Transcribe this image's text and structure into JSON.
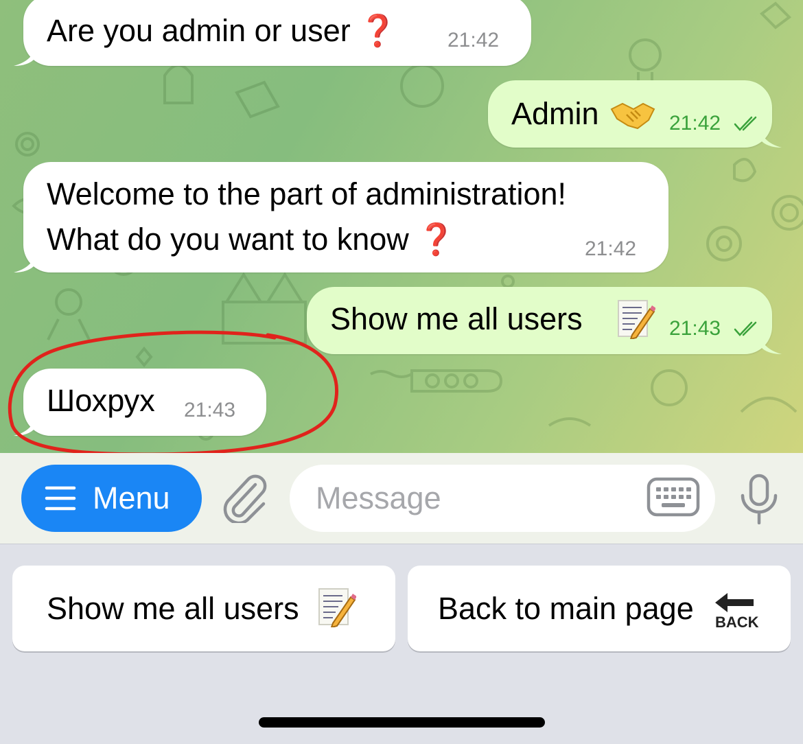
{
  "messages": [
    {
      "text": "Are you admin or user",
      "emoji": "❓",
      "time": "21:42",
      "direction": "incoming"
    },
    {
      "text": "Admin",
      "emoji": "handshake",
      "time": "21:42",
      "direction": "outgoing",
      "status": "read"
    },
    {
      "line1": "Welcome to the part of administration!",
      "line2": "What do you want to know",
      "emoji": "❓",
      "time": "21:42",
      "direction": "incoming"
    },
    {
      "text": "Show me all users",
      "emoji": "memo",
      "time": "21:43",
      "direction": "outgoing",
      "status": "read"
    },
    {
      "text": "Шохрух",
      "time": "21:43",
      "direction": "incoming",
      "highlighted": true
    }
  ],
  "input_bar": {
    "menu_label": "Menu",
    "placeholder": "Message"
  },
  "reply_keyboard": {
    "buttons": [
      {
        "label": "Show me all users",
        "emoji": "memo"
      },
      {
        "label": "Back to main page",
        "emoji": "back-arrow",
        "emoji_text": "BACK"
      }
    ]
  },
  "colors": {
    "accent": "#1a86f5",
    "incoming_bubble": "#ffffff",
    "outgoing_bubble": "#e2fdc9",
    "outgoing_time": "#3aa23b",
    "highlight_circle": "#e0231c"
  }
}
